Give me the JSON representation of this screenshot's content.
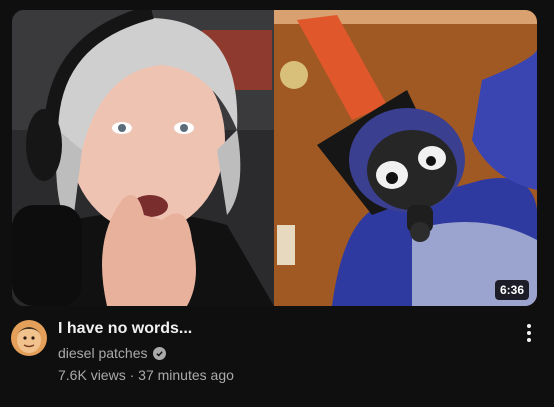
{
  "video": {
    "title": "I have no words...",
    "duration": "6:36",
    "channel": "diesel patches",
    "views": "7.6K views",
    "separator": "·",
    "age": "37 minutes ago"
  },
  "icons": {
    "verified": "verified-check-icon",
    "menu": "more-vert-icon",
    "avatar": "channel-avatar"
  },
  "colors": {
    "background": "#0f0f0f",
    "title": "#f1f1f1",
    "secondary_text": "#aaaaaa",
    "duration_badge": "#000000"
  }
}
